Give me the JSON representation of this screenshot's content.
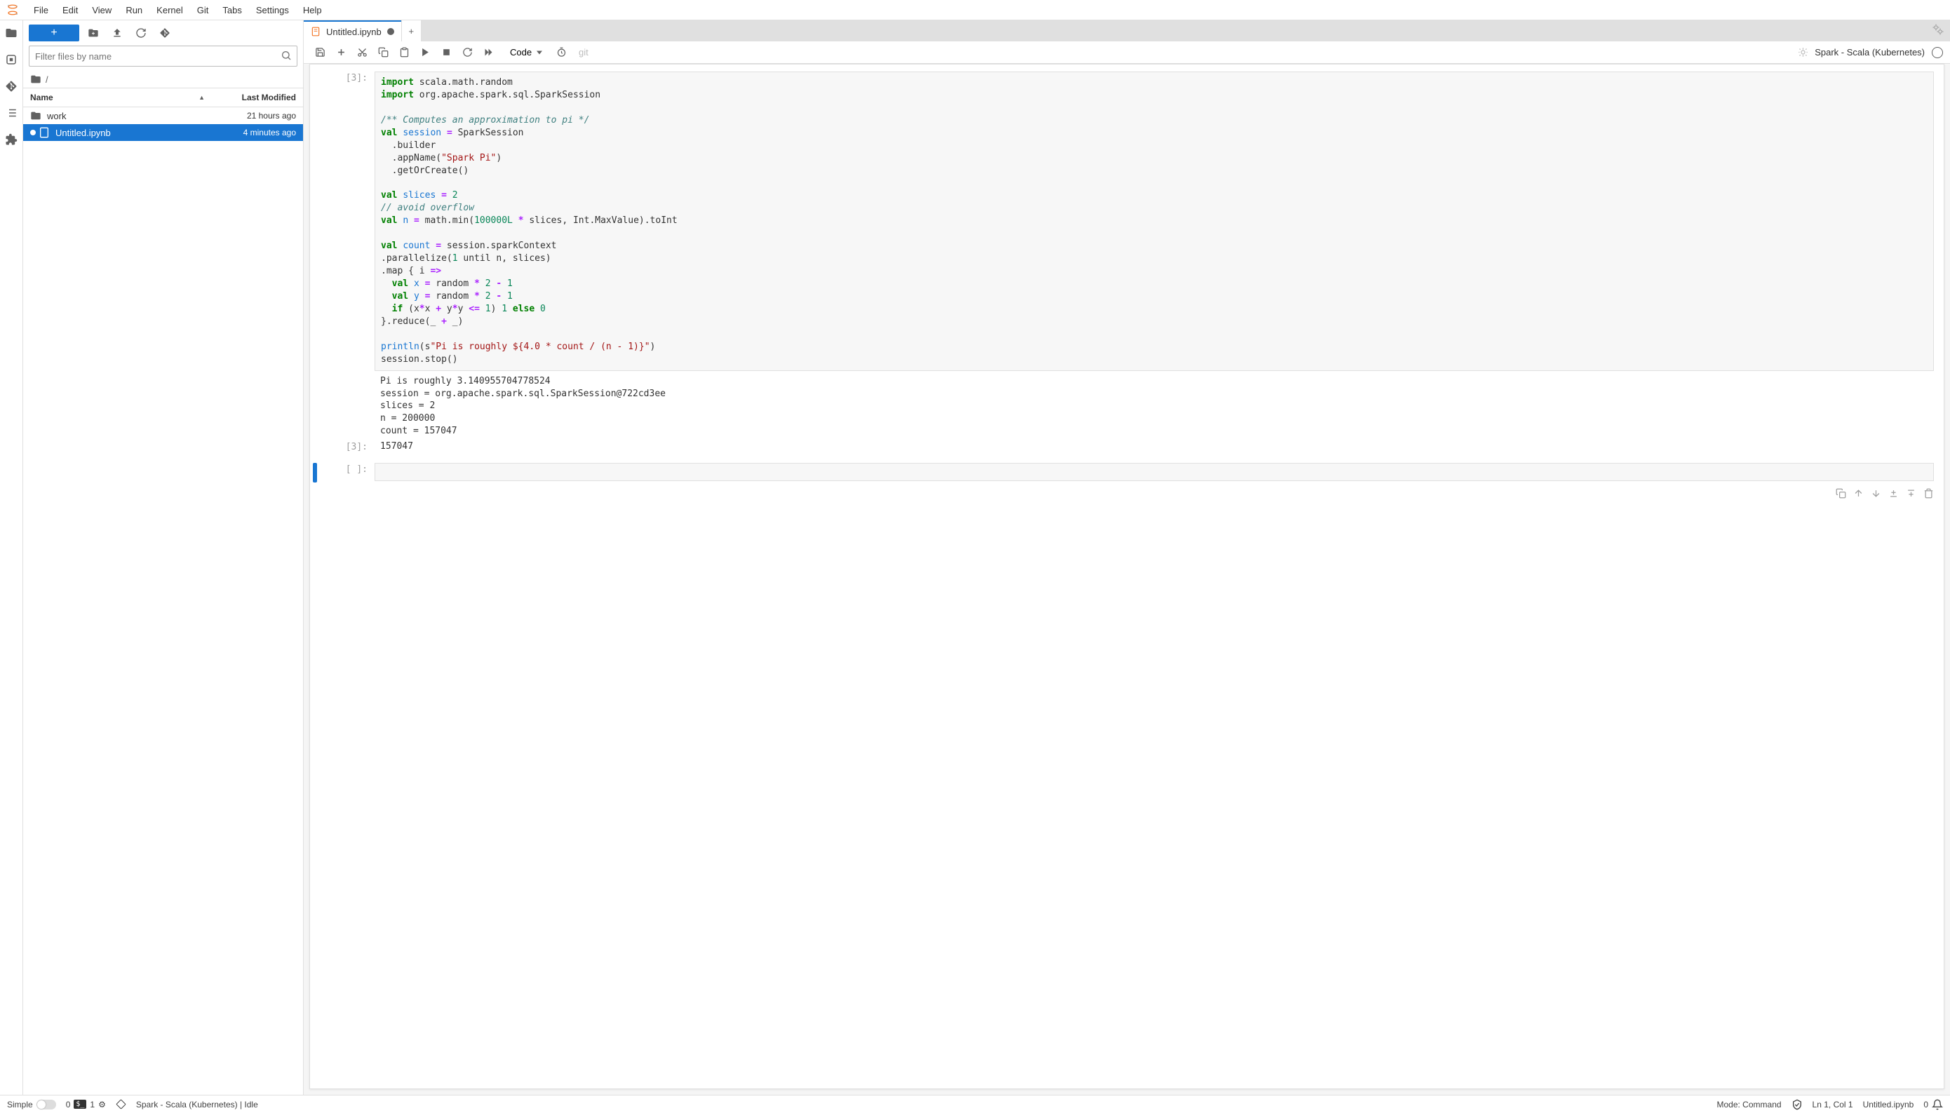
{
  "menu": {
    "items": [
      "File",
      "Edit",
      "View",
      "Run",
      "Kernel",
      "Git",
      "Tabs",
      "Settings",
      "Help"
    ]
  },
  "filebrowser": {
    "filter_placeholder": "Filter files by name",
    "breadcrumb_root": "/",
    "columns": {
      "name": "Name",
      "modified": "Last Modified"
    },
    "items": [
      {
        "type": "folder",
        "name": "work",
        "modified": "21 hours ago",
        "running": false,
        "selected": false
      },
      {
        "type": "notebook",
        "name": "Untitled.ipynb",
        "modified": "4 minutes ago",
        "running": true,
        "selected": true
      }
    ]
  },
  "tabs": [
    {
      "title": "Untitled.ipynb",
      "dirty": true
    }
  ],
  "nb_toolbar": {
    "cell_type": "Code",
    "git_label": "git",
    "kernel_name": "Spark - Scala (Kubernetes)"
  },
  "cells": [
    {
      "prompt_in": "[3]:",
      "code_tokens": [
        [
          "kw",
          "import"
        ],
        [
          "",
          " scala.math.random\n"
        ],
        [
          "kw",
          "import"
        ],
        [
          "",
          " org.apache.spark.sql.SparkSession\n\n"
        ],
        [
          "cmt",
          "/** Computes an approximation to pi */"
        ],
        [
          "",
          "\n"
        ],
        [
          "kw",
          "val"
        ],
        [
          "",
          " "
        ],
        [
          "fn",
          "session"
        ],
        [
          "",
          " "
        ],
        [
          "op",
          "="
        ],
        [
          "",
          " SparkSession\n  .builder\n  .appName("
        ],
        [
          "str",
          "\"Spark Pi\""
        ],
        [
          "",
          ")\n  .getOrCreate()\n\n"
        ],
        [
          "kw",
          "val"
        ],
        [
          "",
          " "
        ],
        [
          "fn",
          "slices"
        ],
        [
          "",
          " "
        ],
        [
          "op",
          "="
        ],
        [
          "",
          " "
        ],
        [
          "num",
          "2"
        ],
        [
          "",
          "\n"
        ],
        [
          "cmt",
          "// avoid overflow"
        ],
        [
          "",
          "\n"
        ],
        [
          "kw",
          "val"
        ],
        [
          "",
          " "
        ],
        [
          "fn",
          "n"
        ],
        [
          "",
          " "
        ],
        [
          "op",
          "="
        ],
        [
          "",
          " math.min("
        ],
        [
          "num",
          "100000L"
        ],
        [
          "",
          " "
        ],
        [
          "op",
          "*"
        ],
        [
          "",
          " slices, Int.MaxValue).toInt\n\n"
        ],
        [
          "kw",
          "val"
        ],
        [
          "",
          " "
        ],
        [
          "fn",
          "count"
        ],
        [
          "",
          " "
        ],
        [
          "op",
          "="
        ],
        [
          "",
          " session.sparkContext\n.parallelize("
        ],
        [
          "num",
          "1"
        ],
        [
          "",
          " until n, slices)\n.map { i "
        ],
        [
          "op",
          "=>"
        ],
        [
          "",
          "\n  "
        ],
        [
          "kw",
          "val"
        ],
        [
          "",
          " "
        ],
        [
          "fn",
          "x"
        ],
        [
          "",
          " "
        ],
        [
          "op",
          "="
        ],
        [
          "",
          " random "
        ],
        [
          "op",
          "*"
        ],
        [
          "",
          " "
        ],
        [
          "num",
          "2"
        ],
        [
          "",
          " "
        ],
        [
          "op",
          "-"
        ],
        [
          "",
          " "
        ],
        [
          "num",
          "1"
        ],
        [
          "",
          "\n  "
        ],
        [
          "kw",
          "val"
        ],
        [
          "",
          " "
        ],
        [
          "fn",
          "y"
        ],
        [
          "",
          " "
        ],
        [
          "op",
          "="
        ],
        [
          "",
          " random "
        ],
        [
          "op",
          "*"
        ],
        [
          "",
          " "
        ],
        [
          "num",
          "2"
        ],
        [
          "",
          " "
        ],
        [
          "op",
          "-"
        ],
        [
          "",
          " "
        ],
        [
          "num",
          "1"
        ],
        [
          "",
          "\n  "
        ],
        [
          "kw",
          "if"
        ],
        [
          "",
          " (x"
        ],
        [
          "op",
          "*"
        ],
        [
          "",
          "x "
        ],
        [
          "op",
          "+"
        ],
        [
          "",
          " y"
        ],
        [
          "op",
          "*"
        ],
        [
          "",
          "y "
        ],
        [
          "op",
          "<="
        ],
        [
          "",
          " "
        ],
        [
          "num",
          "1"
        ],
        [
          "",
          ") "
        ],
        [
          "num",
          "1"
        ],
        [
          "",
          " "
        ],
        [
          "kw",
          "else"
        ],
        [
          "",
          " "
        ],
        [
          "num",
          "0"
        ],
        [
          "",
          "\n}.reduce(_ "
        ],
        [
          "op",
          "+"
        ],
        [
          "",
          " _)\n\n"
        ],
        [
          "fn",
          "println"
        ],
        [
          "",
          "(s"
        ],
        [
          "str",
          "\"Pi is roughly ${4.0 * count / (n - 1)}\""
        ],
        [
          "",
          ")\nsession.stop()"
        ]
      ],
      "stdout": "Pi is roughly 3.140955704778524\nsession = org.apache.spark.sql.SparkSession@722cd3ee\nslices = 2\nn = 200000\ncount = 157047",
      "prompt_out": "[3]:",
      "result": "157047"
    }
  ],
  "empty_cell_prompt": "[ ]:",
  "statusbar": {
    "simple_label": "Simple",
    "terminals": "0",
    "kernels": "1",
    "kernel_status": "Spark - Scala (Kubernetes) | Idle",
    "mode": "Mode: Command",
    "cursor": "Ln 1, Col 1",
    "filename": "Untitled.ipynb",
    "notif_count": "0"
  }
}
